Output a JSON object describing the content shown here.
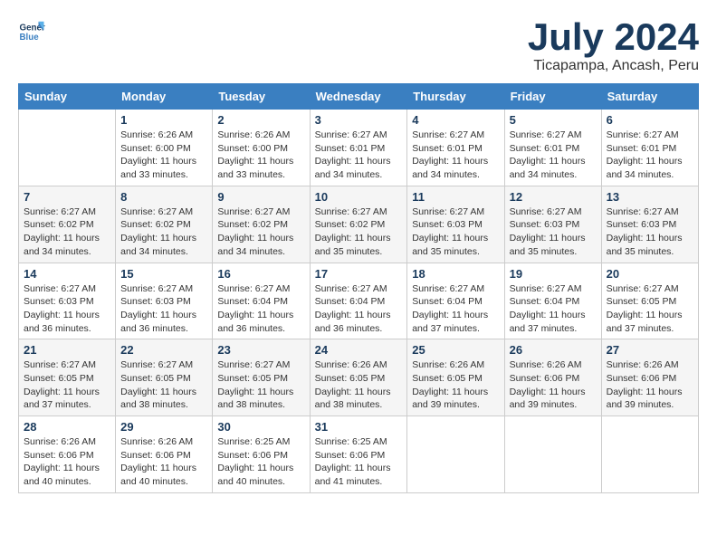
{
  "logo": {
    "general": "General",
    "blue": "Blue"
  },
  "title": "July 2024",
  "subtitle": "Ticapampa, Ancash, Peru",
  "weekdays": [
    "Sunday",
    "Monday",
    "Tuesday",
    "Wednesday",
    "Thursday",
    "Friday",
    "Saturday"
  ],
  "weeks": [
    [
      {
        "day": "",
        "sunrise": "",
        "sunset": "",
        "daylight": ""
      },
      {
        "day": "1",
        "sunrise": "Sunrise: 6:26 AM",
        "sunset": "Sunset: 6:00 PM",
        "daylight": "Daylight: 11 hours and 33 minutes."
      },
      {
        "day": "2",
        "sunrise": "Sunrise: 6:26 AM",
        "sunset": "Sunset: 6:00 PM",
        "daylight": "Daylight: 11 hours and 33 minutes."
      },
      {
        "day": "3",
        "sunrise": "Sunrise: 6:27 AM",
        "sunset": "Sunset: 6:01 PM",
        "daylight": "Daylight: 11 hours and 34 minutes."
      },
      {
        "day": "4",
        "sunrise": "Sunrise: 6:27 AM",
        "sunset": "Sunset: 6:01 PM",
        "daylight": "Daylight: 11 hours and 34 minutes."
      },
      {
        "day": "5",
        "sunrise": "Sunrise: 6:27 AM",
        "sunset": "Sunset: 6:01 PM",
        "daylight": "Daylight: 11 hours and 34 minutes."
      },
      {
        "day": "6",
        "sunrise": "Sunrise: 6:27 AM",
        "sunset": "Sunset: 6:01 PM",
        "daylight": "Daylight: 11 hours and 34 minutes."
      }
    ],
    [
      {
        "day": "7",
        "sunrise": "Sunrise: 6:27 AM",
        "sunset": "Sunset: 6:02 PM",
        "daylight": "Daylight: 11 hours and 34 minutes."
      },
      {
        "day": "8",
        "sunrise": "Sunrise: 6:27 AM",
        "sunset": "Sunset: 6:02 PM",
        "daylight": "Daylight: 11 hours and 34 minutes."
      },
      {
        "day": "9",
        "sunrise": "Sunrise: 6:27 AM",
        "sunset": "Sunset: 6:02 PM",
        "daylight": "Daylight: 11 hours and 34 minutes."
      },
      {
        "day": "10",
        "sunrise": "Sunrise: 6:27 AM",
        "sunset": "Sunset: 6:02 PM",
        "daylight": "Daylight: 11 hours and 35 minutes."
      },
      {
        "day": "11",
        "sunrise": "Sunrise: 6:27 AM",
        "sunset": "Sunset: 6:03 PM",
        "daylight": "Daylight: 11 hours and 35 minutes."
      },
      {
        "day": "12",
        "sunrise": "Sunrise: 6:27 AM",
        "sunset": "Sunset: 6:03 PM",
        "daylight": "Daylight: 11 hours and 35 minutes."
      },
      {
        "day": "13",
        "sunrise": "Sunrise: 6:27 AM",
        "sunset": "Sunset: 6:03 PM",
        "daylight": "Daylight: 11 hours and 35 minutes."
      }
    ],
    [
      {
        "day": "14",
        "sunrise": "Sunrise: 6:27 AM",
        "sunset": "Sunset: 6:03 PM",
        "daylight": "Daylight: 11 hours and 36 minutes."
      },
      {
        "day": "15",
        "sunrise": "Sunrise: 6:27 AM",
        "sunset": "Sunset: 6:03 PM",
        "daylight": "Daylight: 11 hours and 36 minutes."
      },
      {
        "day": "16",
        "sunrise": "Sunrise: 6:27 AM",
        "sunset": "Sunset: 6:04 PM",
        "daylight": "Daylight: 11 hours and 36 minutes."
      },
      {
        "day": "17",
        "sunrise": "Sunrise: 6:27 AM",
        "sunset": "Sunset: 6:04 PM",
        "daylight": "Daylight: 11 hours and 36 minutes."
      },
      {
        "day": "18",
        "sunrise": "Sunrise: 6:27 AM",
        "sunset": "Sunset: 6:04 PM",
        "daylight": "Daylight: 11 hours and 37 minutes."
      },
      {
        "day": "19",
        "sunrise": "Sunrise: 6:27 AM",
        "sunset": "Sunset: 6:04 PM",
        "daylight": "Daylight: 11 hours and 37 minutes."
      },
      {
        "day": "20",
        "sunrise": "Sunrise: 6:27 AM",
        "sunset": "Sunset: 6:05 PM",
        "daylight": "Daylight: 11 hours and 37 minutes."
      }
    ],
    [
      {
        "day": "21",
        "sunrise": "Sunrise: 6:27 AM",
        "sunset": "Sunset: 6:05 PM",
        "daylight": "Daylight: 11 hours and 37 minutes."
      },
      {
        "day": "22",
        "sunrise": "Sunrise: 6:27 AM",
        "sunset": "Sunset: 6:05 PM",
        "daylight": "Daylight: 11 hours and 38 minutes."
      },
      {
        "day": "23",
        "sunrise": "Sunrise: 6:27 AM",
        "sunset": "Sunset: 6:05 PM",
        "daylight": "Daylight: 11 hours and 38 minutes."
      },
      {
        "day": "24",
        "sunrise": "Sunrise: 6:26 AM",
        "sunset": "Sunset: 6:05 PM",
        "daylight": "Daylight: 11 hours and 38 minutes."
      },
      {
        "day": "25",
        "sunrise": "Sunrise: 6:26 AM",
        "sunset": "Sunset: 6:05 PM",
        "daylight": "Daylight: 11 hours and 39 minutes."
      },
      {
        "day": "26",
        "sunrise": "Sunrise: 6:26 AM",
        "sunset": "Sunset: 6:06 PM",
        "daylight": "Daylight: 11 hours and 39 minutes."
      },
      {
        "day": "27",
        "sunrise": "Sunrise: 6:26 AM",
        "sunset": "Sunset: 6:06 PM",
        "daylight": "Daylight: 11 hours and 39 minutes."
      }
    ],
    [
      {
        "day": "28",
        "sunrise": "Sunrise: 6:26 AM",
        "sunset": "Sunset: 6:06 PM",
        "daylight": "Daylight: 11 hours and 40 minutes."
      },
      {
        "day": "29",
        "sunrise": "Sunrise: 6:26 AM",
        "sunset": "Sunset: 6:06 PM",
        "daylight": "Daylight: 11 hours and 40 minutes."
      },
      {
        "day": "30",
        "sunrise": "Sunrise: 6:25 AM",
        "sunset": "Sunset: 6:06 PM",
        "daylight": "Daylight: 11 hours and 40 minutes."
      },
      {
        "day": "31",
        "sunrise": "Sunrise: 6:25 AM",
        "sunset": "Sunset: 6:06 PM",
        "daylight": "Daylight: 11 hours and 41 minutes."
      },
      {
        "day": "",
        "sunrise": "",
        "sunset": "",
        "daylight": ""
      },
      {
        "day": "",
        "sunrise": "",
        "sunset": "",
        "daylight": ""
      },
      {
        "day": "",
        "sunrise": "",
        "sunset": "",
        "daylight": ""
      }
    ]
  ]
}
